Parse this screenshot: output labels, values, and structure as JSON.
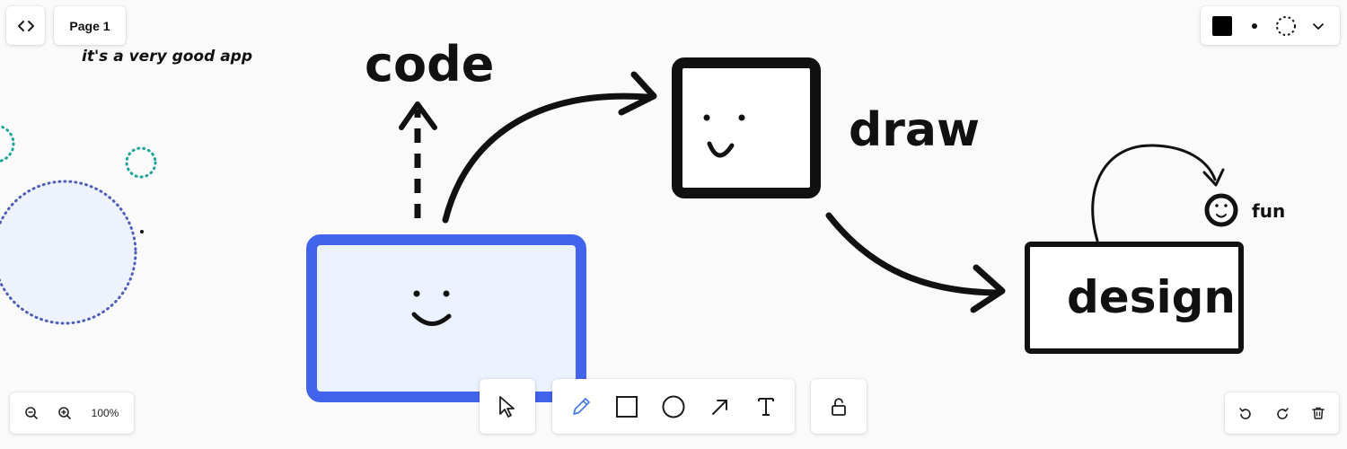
{
  "header": {
    "code_toggle_icon": "code-brackets-icon",
    "page_label": "Page 1"
  },
  "style_panel": {
    "color": "#000000",
    "size_icon": "dot-icon",
    "dash_icon": "dashed-circle-icon",
    "expand_icon": "chevron-down-icon"
  },
  "canvas": {
    "note": "it's a very good app",
    "labels": {
      "code": "code",
      "draw": "draw",
      "design": "design",
      "fun": "fun"
    },
    "colors": {
      "stroke": "#111111",
      "selected_stroke": "#4263eb",
      "selected_fill": "#ebf2fe",
      "teal_dots": "#1aa39a",
      "blue_dots": "#4d5fb8",
      "blue_fill": "#edf2fd"
    }
  },
  "zoom": {
    "zoom_out_icon": "zoom-out-icon",
    "zoom_in_icon": "zoom-in-icon",
    "level": "100%"
  },
  "toolbar": {
    "tools": [
      {
        "name": "select",
        "icon": "cursor-icon"
      },
      {
        "name": "draw",
        "icon": "pencil-icon",
        "active": true,
        "color": "#4a7de8"
      },
      {
        "name": "rectangle",
        "icon": "rectangle-icon"
      },
      {
        "name": "ellipse",
        "icon": "ellipse-icon"
      },
      {
        "name": "arrow",
        "icon": "arrow-icon"
      },
      {
        "name": "text",
        "icon": "text-icon"
      }
    ],
    "lock_icon": "lock-icon"
  },
  "actions": {
    "undo_icon": "undo-icon",
    "redo_icon": "redo-icon",
    "delete_icon": "trash-icon"
  }
}
